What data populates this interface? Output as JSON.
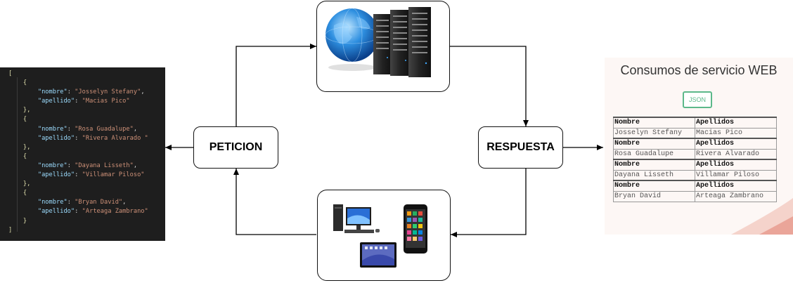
{
  "code": {
    "open_bracket": "[",
    "close_bracket": "]",
    "records": [
      {
        "key1": "\"nombre\"",
        "val1": "\"Josselyn Stefany\"",
        "key2": "\"apellido\"",
        "val2": "\"Macias Pico\""
      },
      {
        "key1": "\"nombre\"",
        "val1": "\"Rosa Guadalupe\"",
        "key2": "\"apellido\"",
        "val2": "\"Rivera Alvarado \""
      },
      {
        "key1": "\"nombre\"",
        "val1": "\"Dayana Lisseth\"",
        "key2": "\"apellido\"",
        "val2": "\"Villamar Piloso\""
      },
      {
        "key1": "\"nombre\"",
        "val1": "\"Bryan David\"",
        "key2": "\"apellido\"",
        "val2": "\"Arteaga Zambrano\""
      }
    ]
  },
  "nodes": {
    "peticion": "PETICION",
    "respuesta": "RESPUESTA"
  },
  "icons": {
    "server": "globe-server-icon",
    "clients": "devices-icon"
  },
  "web": {
    "title": "Consumos de servicio WEB",
    "button": "JSON",
    "header_nombre": "Nombre",
    "header_apellidos": "Apellidos",
    "rows": [
      {
        "nombre": "Josselyn Stefany",
        "apellidos": "Macias Pico"
      },
      {
        "nombre": "Rosa Guadalupe",
        "apellidos": "Rivera Alvarado"
      },
      {
        "nombre": "Dayana Lisseth",
        "apellidos": "Villamar Piloso"
      },
      {
        "nombre": "Bryan David",
        "apellidos": "Arteaga Zambrano"
      }
    ]
  },
  "colors": {
    "code_bg": "#1e1e1e",
    "json_key": "#9cdcfe",
    "json_string": "#ce9178",
    "button_green": "#5cb88a"
  }
}
